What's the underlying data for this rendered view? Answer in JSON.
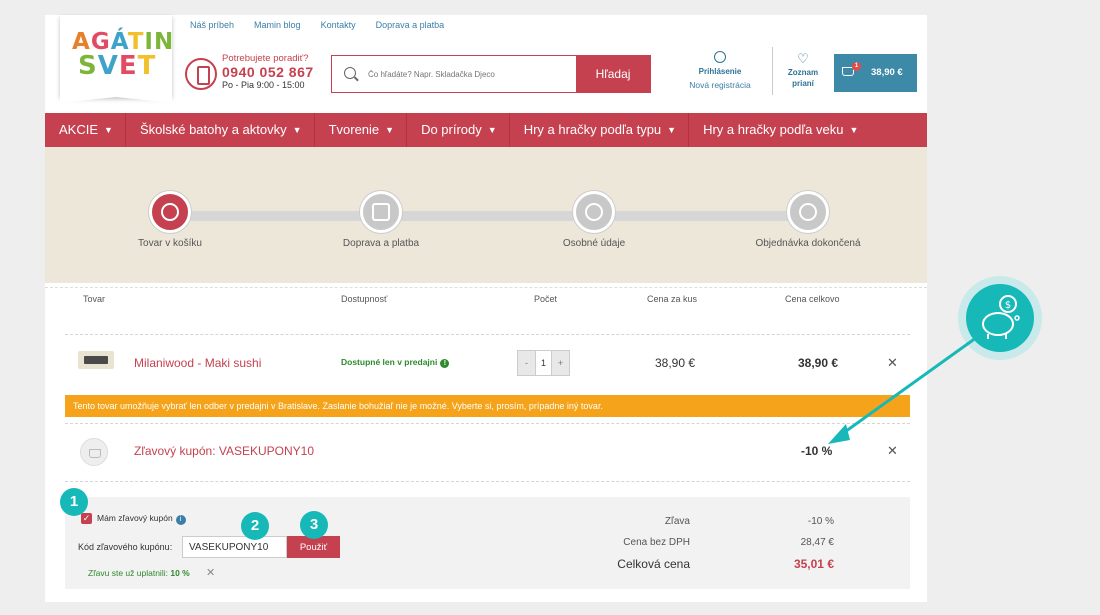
{
  "header": {
    "logo_line1": "AGÁTIN",
    "logo_line2": "SVET",
    "top_links": [
      "Náš príbeh",
      "Mamin blog",
      "Kontakty",
      "Doprava a platba"
    ],
    "phone_question": "Potrebujete poradiť?",
    "phone_number": "0940 052 867",
    "phone_hours": "Po - Pia 9:00 - 15:00",
    "search_placeholder": "Čo hľadáte? Napr. Skladačka Djeco",
    "search_button": "Hľadaj",
    "login_label": "Prihlásenie",
    "register_label": "Nová registrácia",
    "wishlist_label": "Zoznam prianí",
    "cart_count": "1",
    "cart_amount": "38,90 €"
  },
  "nav": [
    "AKCIE",
    "Školské batohy a aktovky",
    "Tvorenie",
    "Do prírody",
    "Hry a hračky podľa typu",
    "Hry a hračky podľa veku"
  ],
  "steps": [
    {
      "label": "Tovar v košíku",
      "icon": "basket-icon",
      "active": true
    },
    {
      "label": "Doprava a platba",
      "icon": "truck-icon",
      "active": false
    },
    {
      "label": "Osobné údaje",
      "icon": "user-icon",
      "active": false
    },
    {
      "label": "Objednávka dokončená",
      "icon": "check-icon",
      "active": false
    }
  ],
  "table": {
    "headers": [
      "Tovar",
      "Dostupnosť",
      "Počet",
      "Cena za kus",
      "Cena celkovo"
    ],
    "product": {
      "name": "Milaniwood - Maki sushi",
      "availability": "Dostupné len v predajni",
      "quantity": "1",
      "unit_price": "38,90 €",
      "total_price": "38,90 €"
    },
    "warning": "Tento tovar umožňuje vybrať len odber v predajni v Bratislave. Zaslanie bohužiaľ nie je možné. Vyberte si, prosím, prípadne iný tovar.",
    "coupon_name": "Zľavový kupón: VASEKUPONY10",
    "coupon_value": "-10 %"
  },
  "coupon_form": {
    "checkbox_label": "Mám zľavový kupón",
    "code_label": "Kód zľavového kupónu:",
    "code_value": "VASEKUPONY10",
    "apply_button": "Použiť",
    "applied_text": "Zľavu ste už uplatnili:",
    "applied_value": "10 %"
  },
  "summary": {
    "discount_label": "Zľava",
    "discount_value": "-10 %",
    "net_label": "Cena bez DPH",
    "net_value": "28,47 €",
    "total_label": "Celková cena",
    "total_value": "35,01 €"
  },
  "annotations": {
    "badges": [
      "1",
      "2",
      "3"
    ],
    "icon": "piggy-bank-icon"
  },
  "colors": {
    "brand_red": "#c6414f",
    "teal": "#17b8b8",
    "warning_orange": "#f5a31a",
    "link_blue": "#3b7fa8"
  }
}
